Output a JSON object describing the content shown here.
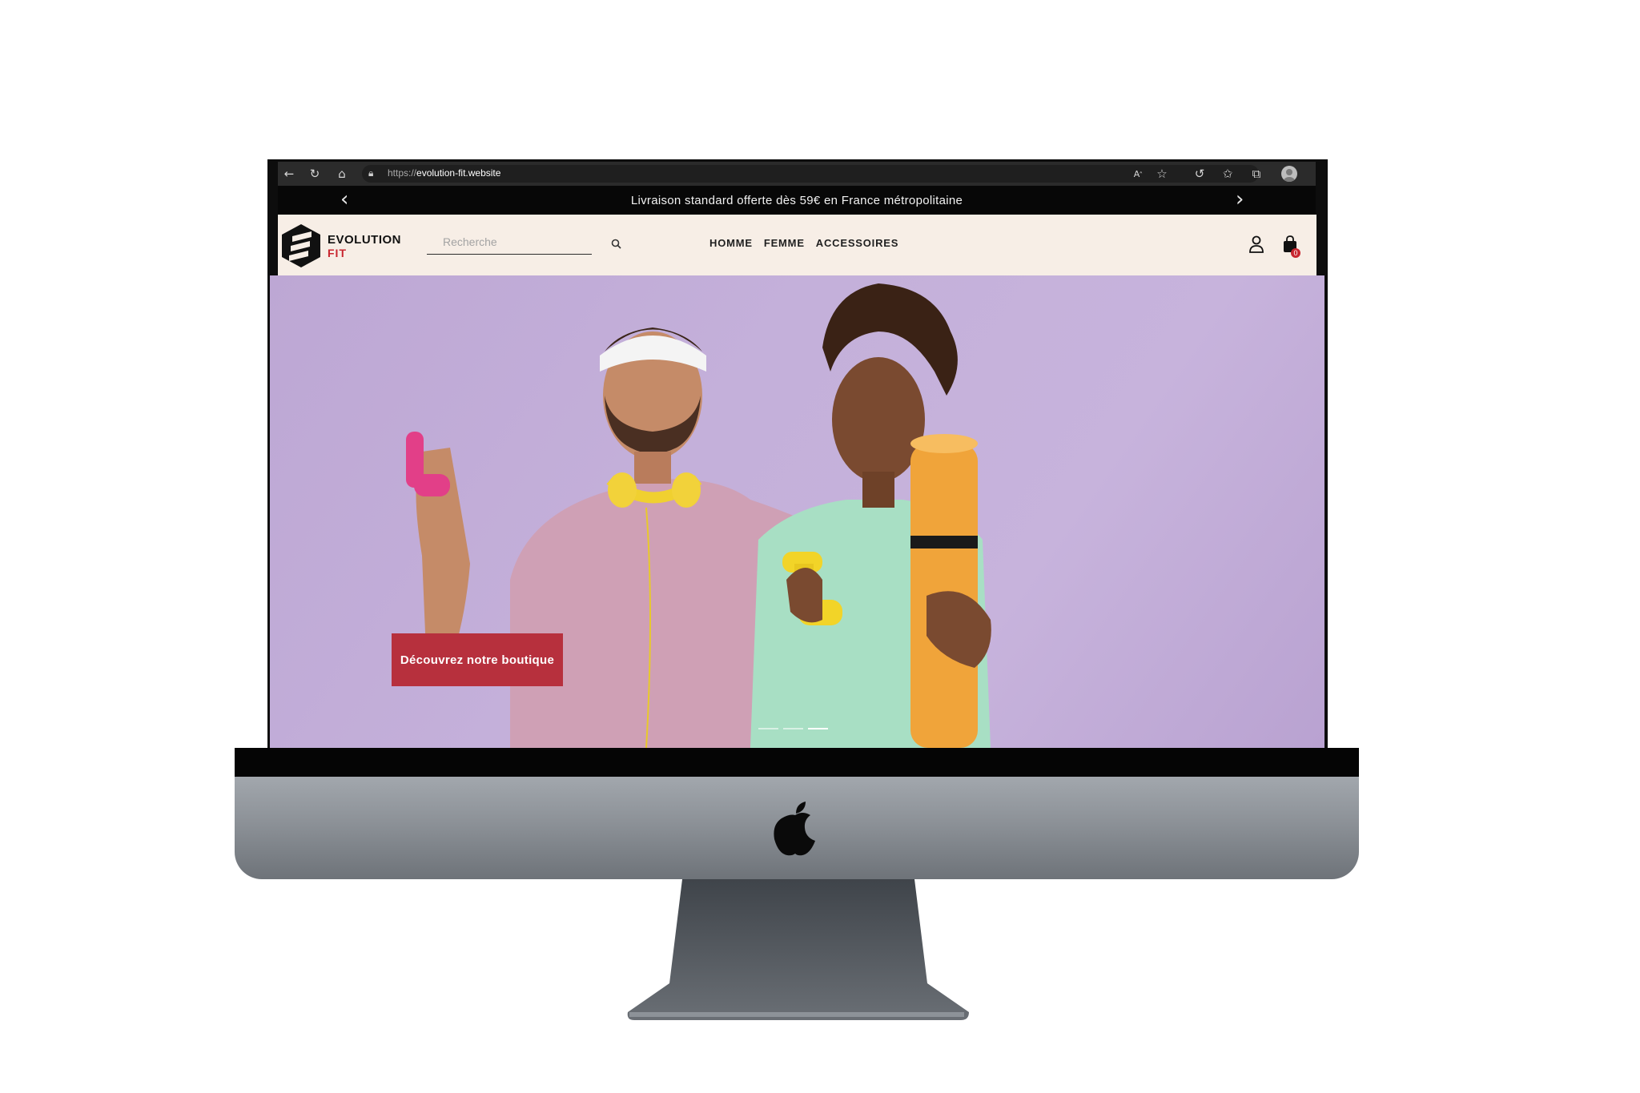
{
  "browser": {
    "url_protocol": "https://",
    "url_domain": "evolution-fit.website",
    "icons": [
      "back-icon",
      "reload-icon",
      "home-icon",
      "lock-icon",
      "read-aloud-icon",
      "favorite-add-icon",
      "refresh-icon",
      "favorites-icon",
      "collections-icon",
      "profile-icon"
    ]
  },
  "announcement": {
    "text": "Livraison standard offerte dès 59€ en France métropolitaine",
    "prev": "‹",
    "next": "›"
  },
  "header": {
    "logo_line1": "EVOLUTION",
    "logo_line2": "FIT",
    "search_placeholder": "Recherche",
    "nav": [
      "HOMME",
      "FEMME",
      "ACCESSOIRES"
    ],
    "cart_count": "0"
  },
  "hero": {
    "cta_label": "Découvrez notre boutique",
    "slides_total": 3,
    "active_slide": 3
  },
  "colors": {
    "accent": "#b7303d",
    "header_bg": "#f7eee6",
    "hero_bg": "#c4b0da",
    "announce_bg": "#070707"
  }
}
